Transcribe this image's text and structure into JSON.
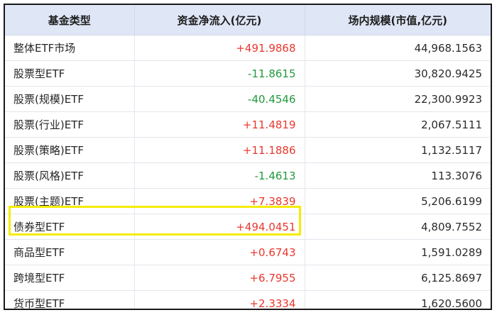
{
  "table": {
    "headers": [
      "基金类型",
      "资金净流入(亿元)",
      "场内规模(市值,亿元)"
    ],
    "rows": [
      {
        "type": "整体ETF市场",
        "net_inflow": "+491.9868",
        "sign": "pos",
        "scale": "44,968.1563"
      },
      {
        "type": "股票型ETF",
        "net_inflow": "-11.8615",
        "sign": "neg",
        "scale": "30,820.9425"
      },
      {
        "type": "股票(规模)ETF",
        "net_inflow": "-40.4546",
        "sign": "neg",
        "scale": "22,300.9923"
      },
      {
        "type": "股票(行业)ETF",
        "net_inflow": "+11.4819",
        "sign": "pos",
        "scale": "2,067.5111"
      },
      {
        "type": "股票(策略)ETF",
        "net_inflow": "+11.1886",
        "sign": "pos",
        "scale": "1,132.5117"
      },
      {
        "type": "股票(风格)ETF",
        "net_inflow": "-1.4613",
        "sign": "neg",
        "scale": "113.3076"
      },
      {
        "type": "股票(主题)ETF",
        "net_inflow": "+7.3839",
        "sign": "pos",
        "scale": "5,206.6199"
      },
      {
        "type": "债券型ETF",
        "net_inflow": "+494.0451",
        "sign": "pos",
        "scale": "4,809.7552",
        "highlighted": true
      },
      {
        "type": "商品型ETF",
        "net_inflow": "+0.6743",
        "sign": "pos",
        "scale": "1,591.0289"
      },
      {
        "type": "跨境型ETF",
        "net_inflow": "+6.7955",
        "sign": "pos",
        "scale": "6,125.8697"
      },
      {
        "type": "货币型ETF",
        "net_inflow": "+2.3334",
        "sign": "pos",
        "scale": "1,620.5600"
      }
    ]
  },
  "colors": {
    "header_bg": "#dfe6f6",
    "positive": "#e8382e",
    "negative": "#219a3c",
    "highlight": "#f5ec00",
    "frame": "#1a1a1a"
  }
}
